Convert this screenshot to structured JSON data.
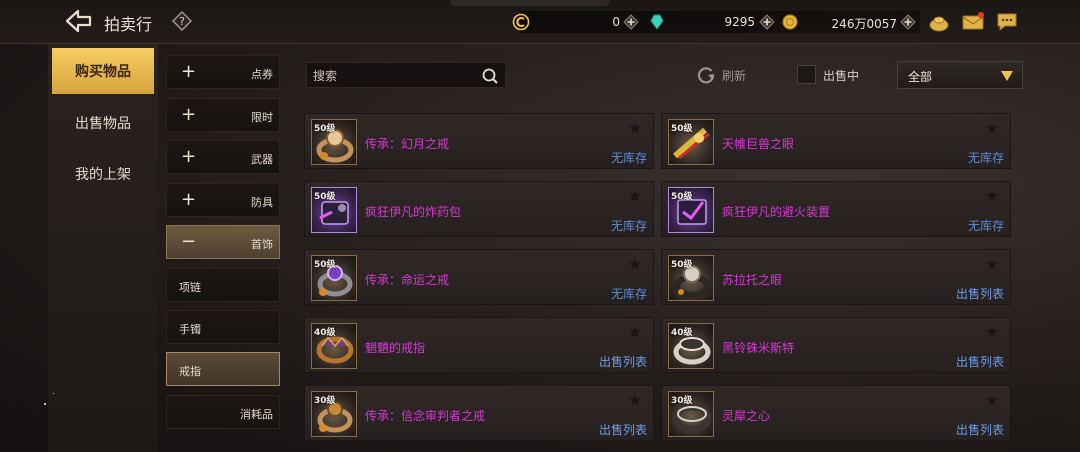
{
  "header": {
    "title": "拍卖行",
    "currencies": [
      {
        "icon": "c-coin-icon",
        "value": "0"
      },
      {
        "icon": "crystal-icon",
        "value": "9295"
      },
      {
        "icon": "gold-coin-icon",
        "value": "246万0057"
      }
    ],
    "colors": {
      "gold": "#f2c15a",
      "crystal": "#3fd1b8",
      "mail_badge": "#e23b2e"
    }
  },
  "tabs": [
    {
      "label": "购买物品",
      "active": true
    },
    {
      "label": "出售物品",
      "active": false
    },
    {
      "label": "我的上架",
      "active": false
    }
  ],
  "subcategories": [
    {
      "label": "点券",
      "sign": "+",
      "state": "collapsed"
    },
    {
      "label": "限时",
      "sign": "+",
      "state": "collapsed"
    },
    {
      "label": "武器",
      "sign": "+",
      "state": "collapsed"
    },
    {
      "label": "防具",
      "sign": "+",
      "state": "collapsed"
    },
    {
      "label": "首饰",
      "sign": "−",
      "state": "expanded"
    },
    {
      "label": "项链",
      "sign": "",
      "state": "child"
    },
    {
      "label": "手镯",
      "sign": "",
      "state": "child"
    },
    {
      "label": "戒指",
      "sign": "",
      "state": "selected"
    },
    {
      "label": "消耗品",
      "sign": "",
      "state": "collapsed"
    }
  ],
  "toolbar": {
    "search_placeholder": "搜索",
    "refresh_label": "刷新",
    "on_sale_label": "出售中",
    "on_sale_checked": false,
    "filter_value": "全部"
  },
  "items": [
    {
      "level": "50级",
      "name": "传承：幻月之戒",
      "status": "无库存",
      "rarity": "epic"
    },
    {
      "level": "50级",
      "name": "天帷巨兽之眼",
      "status": "无库存",
      "rarity": "epic"
    },
    {
      "level": "50级",
      "name": "疯狂伊凡的炸药包",
      "status": "无库存",
      "rarity": "rare"
    },
    {
      "level": "50级",
      "name": "疯狂伊凡的避火装置",
      "status": "无库存",
      "rarity": "rare"
    },
    {
      "level": "50级",
      "name": "传承：命运之戒",
      "status": "无库存",
      "rarity": "epic"
    },
    {
      "level": "50级",
      "name": "苏拉托之眼",
      "status": "出售列表",
      "rarity": "epic"
    },
    {
      "level": "40级",
      "name": "魍魉的戒指",
      "status": "出售列表",
      "rarity": "epic"
    },
    {
      "level": "40级",
      "name": "黑铃铢米斯特",
      "status": "出售列表",
      "rarity": "epic"
    },
    {
      "level": "30级",
      "name": "传承：信念审判者之戒",
      "status": "出售列表",
      "rarity": "epic"
    },
    {
      "level": "30级",
      "name": "灵犀之心",
      "status": "出售列表",
      "rarity": "epic"
    }
  ]
}
